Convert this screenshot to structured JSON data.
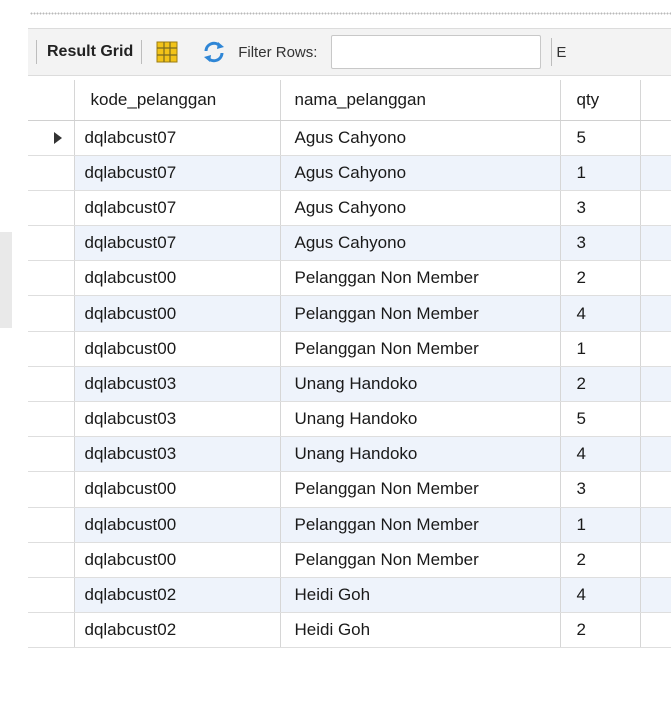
{
  "toolbar": {
    "result_grid_label": "Result Grid",
    "filter_label": "Filter Rows:",
    "filter_value": "",
    "cut_label": "E"
  },
  "icons": {
    "grid": "grid-layout-icon",
    "refresh": "refresh-icon",
    "row_pointer": "row-pointer-icon"
  },
  "colors": {
    "alt_row": "#eef3fb",
    "grid_icon_yellow": "#f2c318",
    "refresh_blue": "#2f86d6"
  },
  "columns": [
    "kode_pelanggan",
    "nama_pelanggan",
    "qty"
  ],
  "rows": [
    [
      "dqlabcust07",
      "Agus Cahyono",
      "5"
    ],
    [
      "dqlabcust07",
      "Agus Cahyono",
      "1"
    ],
    [
      "dqlabcust07",
      "Agus Cahyono",
      "3"
    ],
    [
      "dqlabcust07",
      "Agus Cahyono",
      "3"
    ],
    [
      "dqlabcust00",
      "Pelanggan Non Member",
      "2"
    ],
    [
      "dqlabcust00",
      "Pelanggan Non Member",
      "4"
    ],
    [
      "dqlabcust00",
      "Pelanggan Non Member",
      "1"
    ],
    [
      "dqlabcust03",
      "Unang Handoko",
      "2"
    ],
    [
      "dqlabcust03",
      "Unang Handoko",
      "5"
    ],
    [
      "dqlabcust03",
      "Unang Handoko",
      "4"
    ],
    [
      "dqlabcust00",
      "Pelanggan Non Member",
      "3"
    ],
    [
      "dqlabcust00",
      "Pelanggan Non Member",
      "1"
    ],
    [
      "dqlabcust00",
      "Pelanggan Non Member",
      "2"
    ],
    [
      "dqlabcust02",
      "Heidi Goh",
      "4"
    ],
    [
      "dqlabcust02",
      "Heidi Goh",
      "2"
    ]
  ]
}
